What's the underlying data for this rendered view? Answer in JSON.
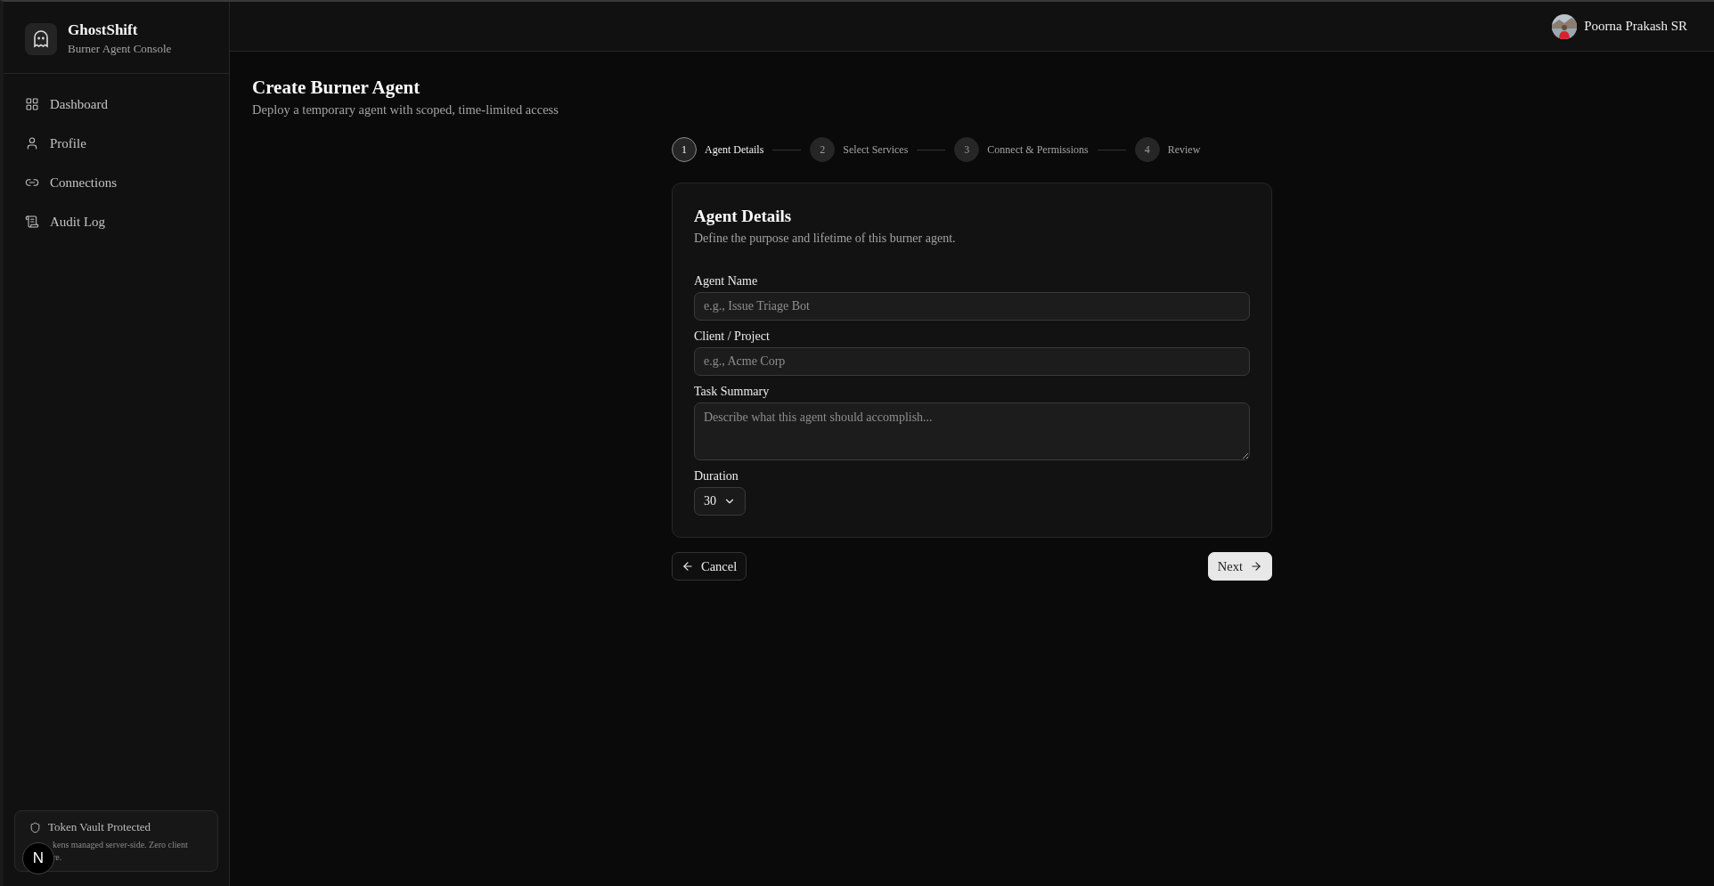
{
  "sidebar": {
    "brand": {
      "name": "GhostShift",
      "subtitle": "Burner Agent Console"
    },
    "nav": [
      {
        "label": "Dashboard",
        "selected": false
      },
      {
        "label": "Profile",
        "selected": false
      },
      {
        "label": "Connections",
        "selected": false
      },
      {
        "label": "Audit Log",
        "selected": false
      }
    ],
    "vault": {
      "title": "Token Vault Protected",
      "lines": [
        "kens managed server-side. Zero client",
        "re."
      ],
      "badge": "N"
    }
  },
  "topbar": {
    "user": {
      "name": "Poorna Prakash SR"
    }
  },
  "page": {
    "title": "Create Burner Agent",
    "subtitle": "Deploy a temporary agent with scoped, time-limited access"
  },
  "steps": [
    {
      "number": "1",
      "label": "Agent Details",
      "selected": true
    },
    {
      "number": "2",
      "label": "Select Services",
      "selected": false
    },
    {
      "number": "3",
      "label": "Connect & Permissions",
      "selected": false
    },
    {
      "number": "4",
      "label": "Review",
      "selected": false
    }
  ],
  "card": {
    "title": "Agent Details",
    "subtitle": "Define the purpose and lifetime of this burner agent.",
    "fields": [
      {
        "kind": "input",
        "label": "Agent Name",
        "placeholder": "e.g., Issue Triage Bot"
      },
      {
        "kind": "input",
        "label": "Client / Project",
        "placeholder": "e.g., Acme Corp"
      },
      {
        "kind": "textarea",
        "label": "Task Summary",
        "placeholder": "Describe what this agent should accomplish..."
      },
      {
        "kind": "select",
        "label": "Duration",
        "value": "30"
      }
    ]
  },
  "buttons": {
    "back": "Cancel",
    "next": "Next"
  }
}
